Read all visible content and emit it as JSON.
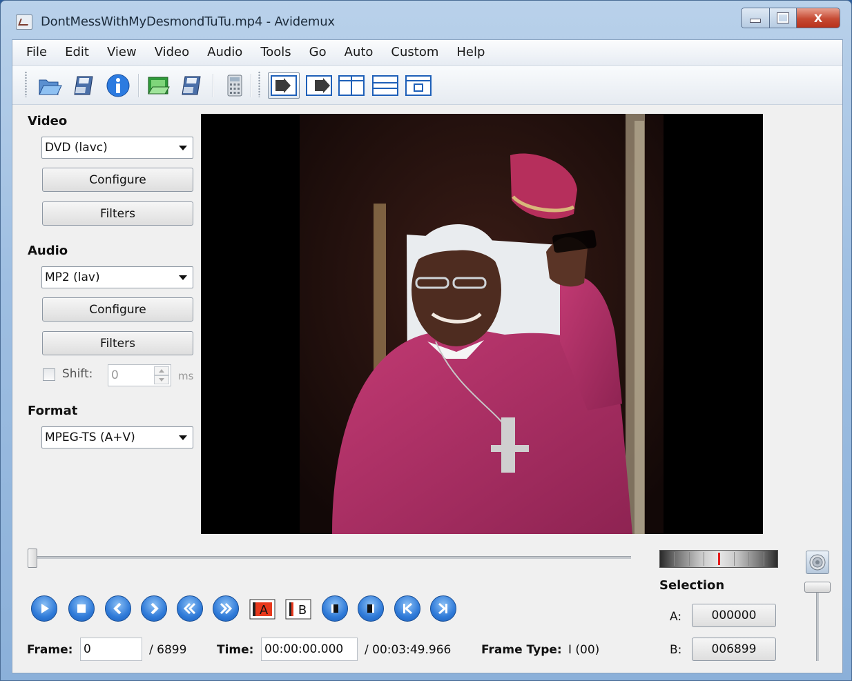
{
  "window": {
    "title": "DontMessWithMyDesmondTuTu.mp4 - Avidemux",
    "controls": {
      "minimize": "minimize",
      "maximize": "maximize",
      "close": "X"
    }
  },
  "menubar": [
    "File",
    "Edit",
    "View",
    "Video",
    "Audio",
    "Tools",
    "Go",
    "Auto",
    "Custom",
    "Help"
  ],
  "toolbar": {
    "icons": [
      "open-folder-icon",
      "save-icon",
      "info-icon",
      "open-video-icon",
      "save-video-icon",
      "calculator-icon",
      "display-input-icon",
      "display-output-icon",
      "side-by-side-icon",
      "top-bottom-icon",
      "preview-icon"
    ]
  },
  "video": {
    "section_label": "Video",
    "codec": "DVD (lavc)",
    "configure_label": "Configure",
    "filters_label": "Filters"
  },
  "audio": {
    "section_label": "Audio",
    "codec": "MP2 (lav)",
    "configure_label": "Configure",
    "filters_label": "Filters",
    "shift_label": "Shift:",
    "shift_value": "0",
    "shift_unit": "ms",
    "shift_enabled": false
  },
  "format": {
    "section_label": "Format",
    "container": "MPEG-TS (A+V)"
  },
  "preview": {
    "description_icon": "video-frame"
  },
  "selection": {
    "title": "Selection",
    "a_label": "A:",
    "a_value": "000000",
    "b_label": "B:",
    "b_value": "006899"
  },
  "playback": {
    "buttons": [
      "play-icon",
      "stop-icon",
      "previous-frame-icon",
      "next-frame-icon",
      "previous-keyframe-icon",
      "next-keyframe-icon",
      "set-marker-a-icon",
      "set-marker-b-icon",
      "previous-black-frame-icon",
      "next-black-frame-icon",
      "goto-first-frame-icon",
      "goto-last-frame-icon"
    ],
    "marker_a_text": "A",
    "marker_b_text": "B"
  },
  "status": {
    "frame_label": "Frame:",
    "frame_value": "0",
    "frame_total": "/ 6899",
    "time_label": "Time:",
    "time_value": "00:00:00.000",
    "time_total": "/ 00:03:49.966",
    "frame_type_label": "Frame Type:",
    "frame_type_value": "I (00)"
  },
  "timeline": {
    "position_fraction": 0.0
  },
  "colors": {
    "accent_blue": "#2f7ad8",
    "marker_red": "#e41b1b",
    "robe": "#b8336a"
  }
}
